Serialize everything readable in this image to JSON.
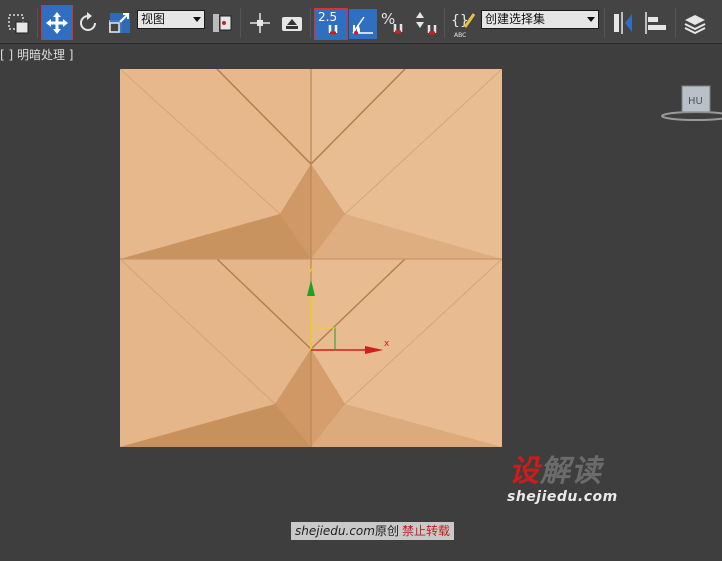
{
  "toolbar": {
    "reference_coord_value": "视图",
    "spinner_snap_value": "2.5",
    "percent_snap_label": "%",
    "edit_named_sel_label": "ABC",
    "named_selection_value": "创建选择集"
  },
  "viewport": {
    "label": "[ ] 明暗处理 ]",
    "gizmo_y_label": "y",
    "gizmo_x_label": "x",
    "viewcube_label": "HU"
  },
  "watermark": {
    "logo_part1": "设",
    "logo_part2": "解读",
    "url": "shejiedu.com",
    "footer_site": "shejiedu.com",
    "footer_text": "原创",
    "footer_warning": "禁止转载"
  },
  "colors": {
    "model_fill": "#e2b184",
    "gizmo_x": "#d01e1e",
    "gizmo_y": "#1e9e2a",
    "active_blue": "#2e6fc2",
    "watermark_red": "#c81e1e"
  }
}
